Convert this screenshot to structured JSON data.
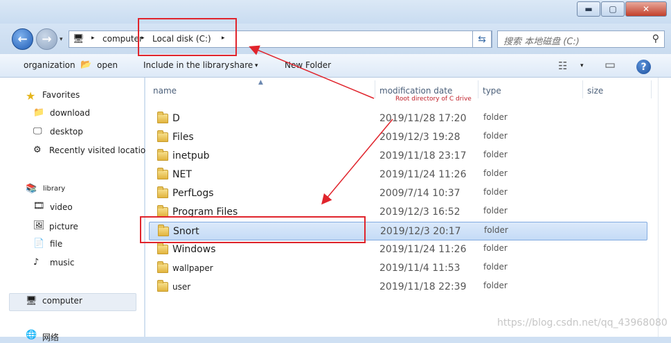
{
  "window": {
    "minimize_label": "▬",
    "maximize_label": "▢",
    "close_label": "✕"
  },
  "nav_buttons": {
    "back_label": "←",
    "forward_label": "→",
    "history_label": "▾"
  },
  "address": {
    "icon": "computer-icon",
    "crumbs": [
      "computer",
      "Local disk (C:)"
    ],
    "separator": "▸",
    "dropdown_label": "▾",
    "refresh_label": "⇆"
  },
  "search": {
    "placeholder": "搜索 本地磁盘 (C:)",
    "icon_label": "⚲"
  },
  "toolbar": {
    "organize": "organization",
    "open": "open",
    "include_library": "Include in the library",
    "share": "share",
    "share_caret": "▾",
    "new_folder": "New Folder",
    "view_caret": "▾",
    "help": "?"
  },
  "sidebar": {
    "favorites": "Favorites",
    "download": "download",
    "desktop": "desktop",
    "recent": "Recently visited location",
    "library": "library",
    "video": "video",
    "picture": "picture",
    "file": "file",
    "music": "music",
    "computer": "computer",
    "network": "网络"
  },
  "columns": {
    "name": "name",
    "modified": "modification date",
    "type": "type",
    "size": "size"
  },
  "files": [
    {
      "name": "D",
      "date": "2019/11/28 17:20",
      "type": "folder"
    },
    {
      "name": "Files",
      "date": "2019/12/3 19:28",
      "type": "folder"
    },
    {
      "name": "inetpub",
      "date": "2019/11/18 23:17",
      "type": "folder"
    },
    {
      "name": "NET",
      "date": "2019/11/24 11:26",
      "type": "folder"
    },
    {
      "name": "PerfLogs",
      "date": "2009/7/14 10:37",
      "type": "folder"
    },
    {
      "name": "Program Files",
      "date": "2019/12/3 16:52",
      "type": "folder"
    },
    {
      "name": "Snort",
      "date": "2019/12/3 20:17",
      "type": "folder",
      "selected": true
    },
    {
      "name": "Windows",
      "date": "2019/11/24 11:26",
      "type": "folder"
    },
    {
      "name": "wallpaper",
      "date": "2019/11/4 11:53",
      "type": "folder"
    },
    {
      "name": "user",
      "date": "2019/11/18 22:39",
      "type": "folder"
    }
  ],
  "annotation": {
    "text": "Root directory of C drive",
    "color": "#e0242c"
  },
  "watermark": "https://blog.csdn.net/qq_43968080"
}
